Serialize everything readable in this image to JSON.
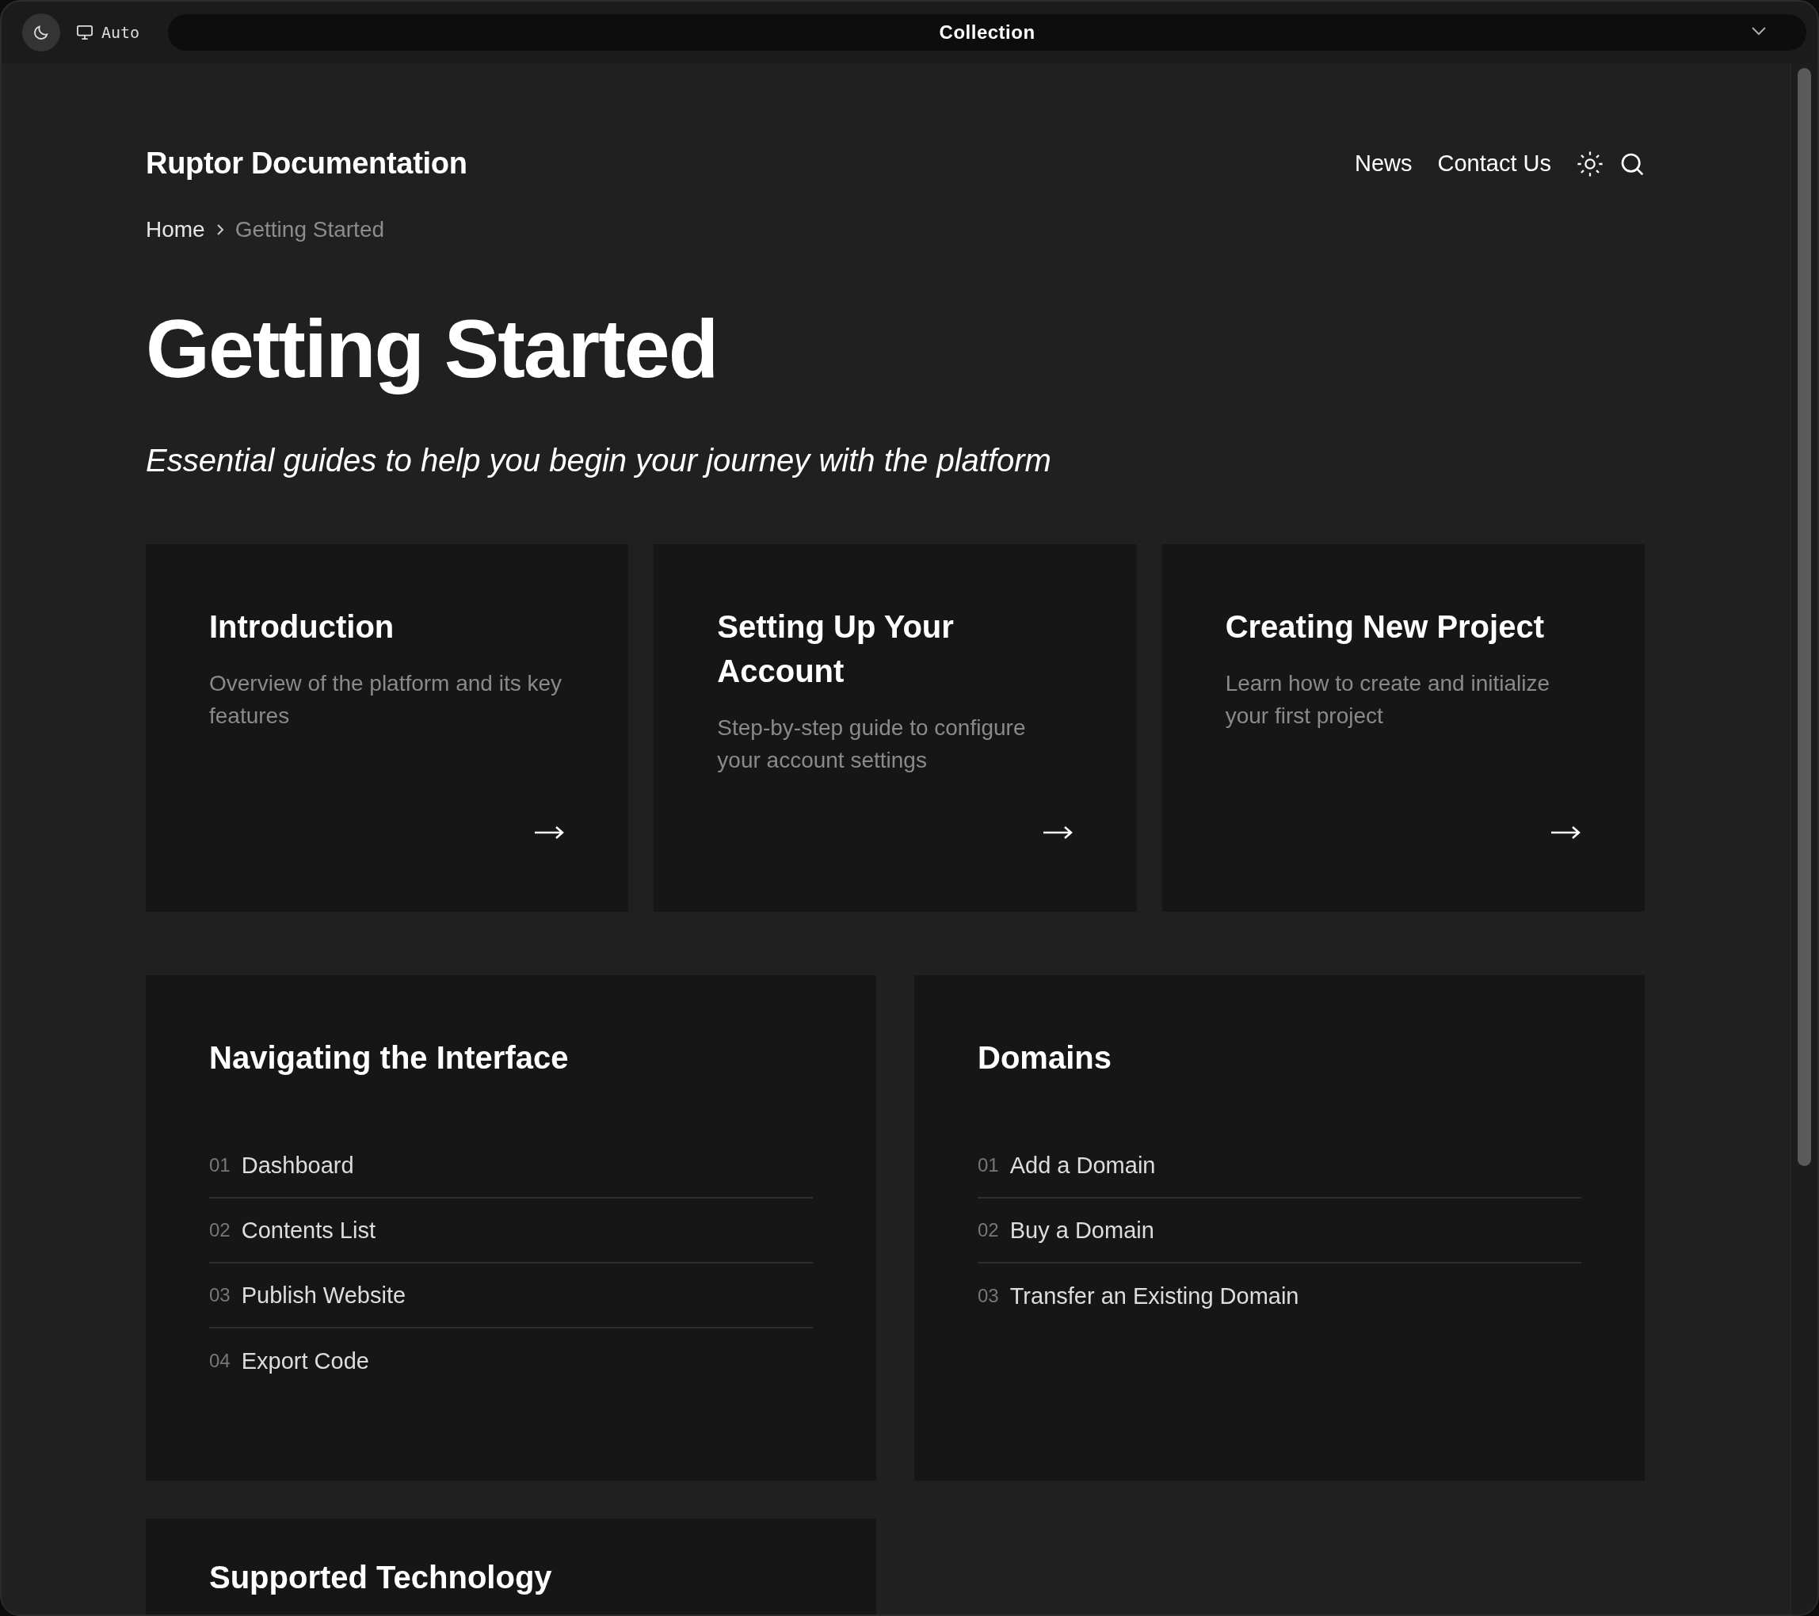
{
  "toolbar": {
    "mode_label": "Auto",
    "collection": "Collection"
  },
  "header": {
    "logo": "Ruptor Documentation",
    "nav": [
      "News",
      "Contact Us"
    ]
  },
  "breadcrumb": [
    {
      "label": "Home",
      "current": false
    },
    {
      "label": "Getting Started",
      "current": true
    }
  ],
  "title": "Getting Started",
  "subtitle": "Essential guides to help you begin your journey with the platform",
  "guide_cards": [
    {
      "title": "Introduction",
      "description": "Overview of the platform and its key features"
    },
    {
      "title": "Setting Up Your Account",
      "description": "Step-by-step guide to configure your account settings"
    },
    {
      "title": "Creating New Project",
      "description": "Learn how to create and initialize your first project"
    }
  ],
  "sections": [
    {
      "title": "Navigating the Interface",
      "items": [
        {
          "number": "01",
          "label": "Dashboard"
        },
        {
          "number": "02",
          "label": "Contents List"
        },
        {
          "number": "03",
          "label": "Publish Website"
        },
        {
          "number": "04",
          "label": "Export Code"
        }
      ]
    },
    {
      "title": "Domains",
      "items": [
        {
          "number": "01",
          "label": "Add a Domain"
        },
        {
          "number": "02",
          "label": "Buy a Domain"
        },
        {
          "number": "03",
          "label": "Transfer an Existing Domain"
        }
      ]
    },
    {
      "title": "Supported Technology"
    }
  ]
}
